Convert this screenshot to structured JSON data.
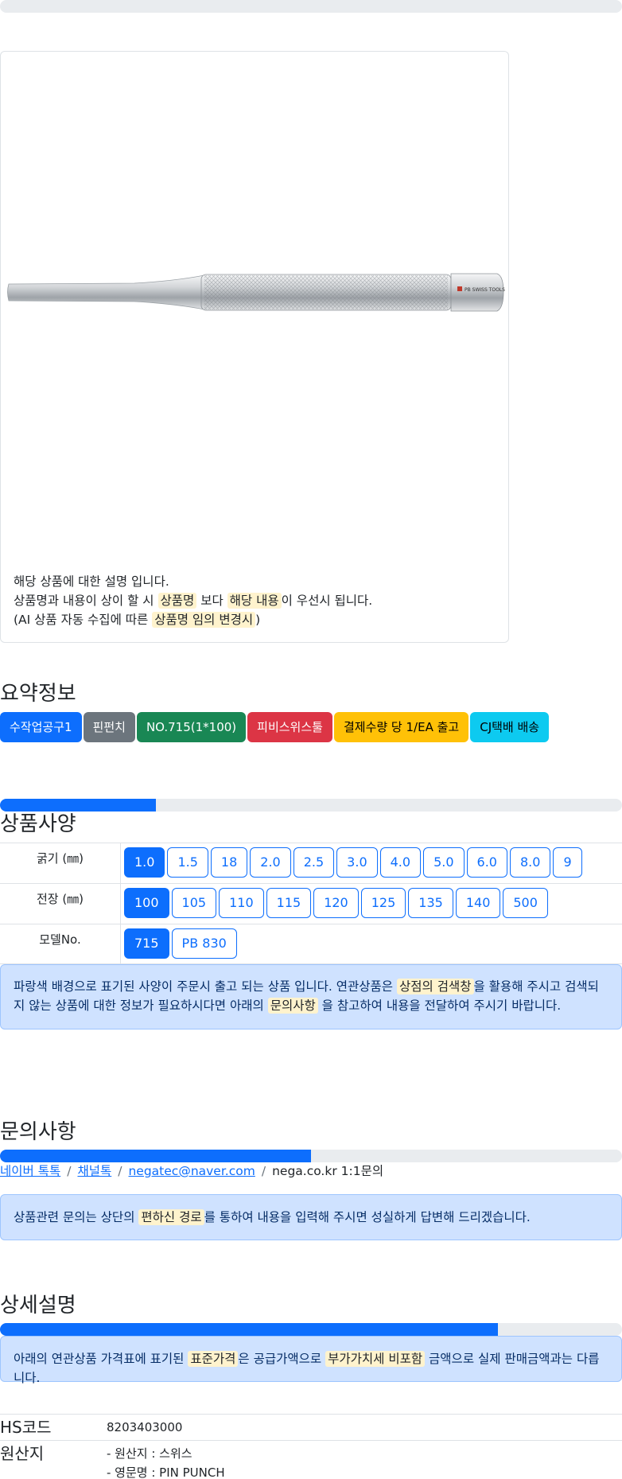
{
  "top_progress": 0,
  "product_card": {
    "desc_line1": "해당 상품에 대한 설명 입니다.",
    "desc_line2_pre": "상품명과 내용이 상이 할 시 ",
    "desc_line2_mark1": "상품명",
    "desc_line2_mid": " 보다 ",
    "desc_line2_mark2": "해당 내용",
    "desc_line2_post": "이 우선시 됩니다.",
    "desc_line3_pre": "(AI 상품 자동 수집에 따른 ",
    "desc_line3_mark": "상품명 임의 변경시",
    "desc_line3_post": ")"
  },
  "summary": {
    "title": "요약정보",
    "badges": [
      {
        "label": "수작업공구1",
        "color": "#0d6efd"
      },
      {
        "label": "핀펀치",
        "color": "#6c757d"
      },
      {
        "label": "NO.715(1*100)",
        "color": "#198754"
      },
      {
        "label": "피비스위스툴",
        "color": "#dc3545"
      },
      {
        "label": "결제수량 당 1/EA 출고",
        "color": "#ffc107"
      },
      {
        "label": "CJ택배 배송",
        "color": "#0dcaf0"
      }
    ]
  },
  "spec": {
    "progress": 0.25,
    "title": "상품사양",
    "rows": [
      {
        "label": "굵기 (㎜)",
        "options": [
          "1.0",
          "1.5",
          "18",
          "2.0",
          "2.5",
          "3.0",
          "4.0",
          "5.0",
          "6.0",
          "8.0",
          "9"
        ],
        "selected": 0
      },
      {
        "label": "전장 (㎜)",
        "options": [
          "100",
          "105",
          "110",
          "115",
          "120",
          "125",
          "135",
          "140",
          "500"
        ],
        "selected": 0
      },
      {
        "label": "모델No.",
        "options": [
          "715",
          "PB 830"
        ],
        "selected": 0
      }
    ],
    "notice_pre": "파랑색 배경으로 표기된 사양이 주문시 출고 되는 상품 입니다. 연관상품은 ",
    "notice_mark1": "상점의 검색창",
    "notice_mid": "을 활용해 주시고 검색되지 않는 상품에 대한 정보가 필요하시다면 아래의 ",
    "notice_mark2": "문의사항",
    "notice_post": " 을 참고하여 내용을 전달하여 주시기 바랍니다."
  },
  "inquiry": {
    "title": "문의사항",
    "progress": 0.5,
    "link1": "네이버 톡톡",
    "link2": "채널톡",
    "link3": "negatec@naver.com",
    "plain": "nega.co.kr 1:1문의",
    "sep": "/",
    "notice_pre": "상품관련 문의는 상단의 ",
    "notice_mark": "편하신 경로",
    "notice_post": "를 통하여 내용을 입력해 주시면 성실하게 답변해 드리겠습니다."
  },
  "detail": {
    "title": "상세설명",
    "progress": 0.8,
    "notice_pre": "아래의 연관상품 가격표에 표기된 ",
    "notice_mark1": "표준가격",
    "notice_mid": "은 공급가액으로 ",
    "notice_mark2": "부가가치세 비포함",
    "notice_post": " 금액으로 실제 판매금액과는 다릅니다.",
    "hs_key": "HS코드",
    "hs_value": "8203403000",
    "origin_key": "원산지",
    "origin_line1": "- 원산지 : 스위스",
    "origin_line2": "- 영문명 : PIN PUNCH"
  },
  "image_label": "PB SWISS TOOLS"
}
